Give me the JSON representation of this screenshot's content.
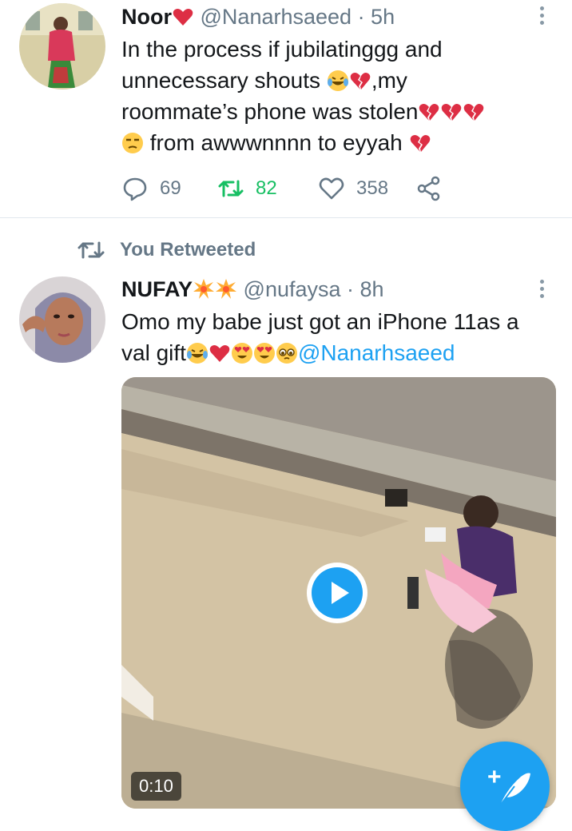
{
  "tweet1": {
    "name": "Noor",
    "handle": "@Nanarhsaeed",
    "time": "· 5h",
    "text_line1": "In the process if jubilatinggg and",
    "text_line2_a": "unnecessary shouts ",
    "text_line2_b": ",my",
    "text_line3": "roommate’s phone was stolen",
    "text_line4": " from awwwnnnn to eyyah ",
    "replies": "69",
    "retweets": "82",
    "likes": "358"
  },
  "retweet_banner": {
    "label": "You Retweeted"
  },
  "tweet2": {
    "name": "NUFAY",
    "handle": "@nufaysa",
    "time": "· 8h",
    "text_line1": "Omo my babe just got an iPhone 11as a",
    "text_line2": "val gift",
    "mention": "@Nanarhsaeed",
    "video_duration": "0:10"
  },
  "fab": {
    "label": "+"
  },
  "colors": {
    "accent": "#1da1f2",
    "retweet_green": "#17bf63",
    "muted": "#657786"
  }
}
